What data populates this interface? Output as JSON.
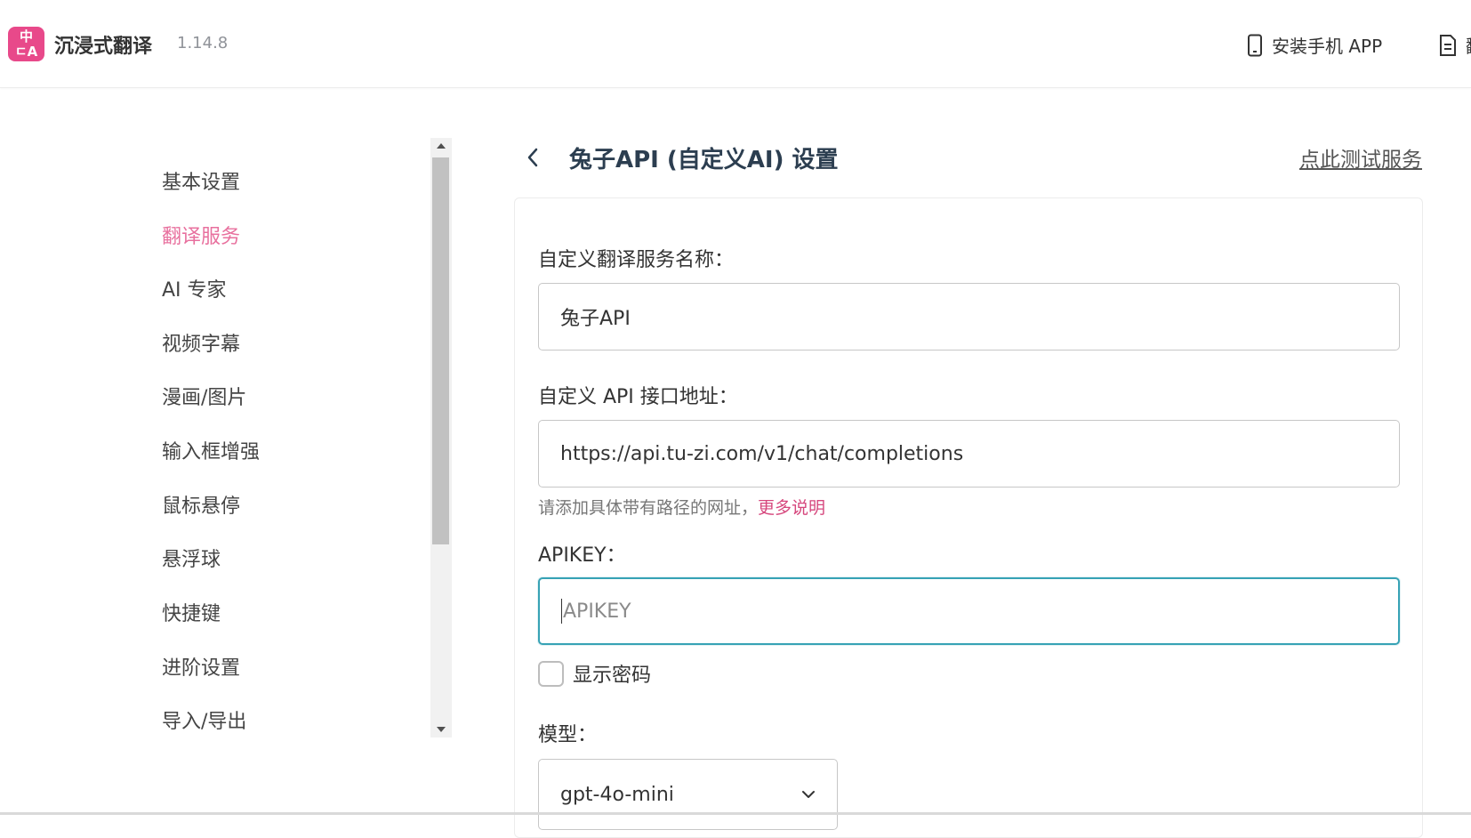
{
  "header": {
    "logo_top": "中",
    "logo_bottom": "ㄷA",
    "app_name": "沉浸式翻译",
    "version": "1.14.8",
    "install_app_label": "安装手机 APP",
    "second_link_label": "翻"
  },
  "sidebar": {
    "items": [
      {
        "label": "基本设置",
        "active": false
      },
      {
        "label": "翻译服务",
        "active": true
      },
      {
        "label": "AI 专家",
        "active": false
      },
      {
        "label": "视频字幕",
        "active": false
      },
      {
        "label": "漫画/图片",
        "active": false
      },
      {
        "label": "输入框增强",
        "active": false
      },
      {
        "label": "鼠标悬停",
        "active": false
      },
      {
        "label": "悬浮球",
        "active": false
      },
      {
        "label": "快捷键",
        "active": false
      },
      {
        "label": "进阶设置",
        "active": false
      },
      {
        "label": "导入/导出",
        "active": false
      }
    ]
  },
  "main": {
    "title": "兔子API (自定义AI) 设置",
    "test_service_link": "点此测试服务",
    "service_name": {
      "label": "自定义翻译服务名称：",
      "value": "兔子API"
    },
    "api_url": {
      "label": "自定义 API 接口地址：",
      "value": "https://api.tu-zi.com/v1/chat/completions",
      "hint": "请添加具体带有路径的网址，",
      "hint_link": "更多说明"
    },
    "apikey": {
      "label": "APIKEY：",
      "value": "",
      "placeholder": "APIKEY"
    },
    "show_password": {
      "label": "显示密码",
      "checked": false
    },
    "model": {
      "label": "模型：",
      "selected": "gpt-4o-mini"
    }
  },
  "colors": {
    "brand": "#e8498a",
    "active_nav": "#e8709e",
    "link": "#d6477d",
    "focus": "#37a2b5"
  }
}
